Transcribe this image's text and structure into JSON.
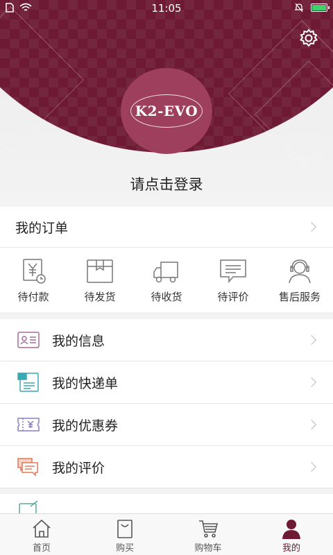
{
  "status_bar": {
    "time": "11:05"
  },
  "brand": {
    "logo_text": "K2-EVO",
    "accent_color": "#6e1a35"
  },
  "header": {
    "login_prompt": "请点击登录"
  },
  "orders": {
    "title": "我的订单",
    "items": [
      {
        "label": "待付款",
        "icon": "pending-payment-icon"
      },
      {
        "label": "待发货",
        "icon": "pending-shipment-icon"
      },
      {
        "label": "待收货",
        "icon": "pending-receipt-icon"
      },
      {
        "label": "待评价",
        "icon": "pending-review-icon"
      },
      {
        "label": "售后服务",
        "icon": "after-sales-icon"
      }
    ]
  },
  "menu": {
    "items": [
      {
        "label": "我的信息",
        "icon": "profile-card-icon"
      },
      {
        "label": "我的快递单",
        "icon": "delivery-note-icon"
      },
      {
        "label": "我的优惠券",
        "icon": "coupon-icon"
      },
      {
        "label": "我的评价",
        "icon": "comment-icon"
      }
    ]
  },
  "tabs": [
    {
      "label": "首页",
      "icon": "home-icon"
    },
    {
      "label": "购买",
      "icon": "shopping-bag-icon"
    },
    {
      "label": "购物车",
      "icon": "cart-icon"
    },
    {
      "label": "我的",
      "icon": "user-icon",
      "active": true
    }
  ]
}
